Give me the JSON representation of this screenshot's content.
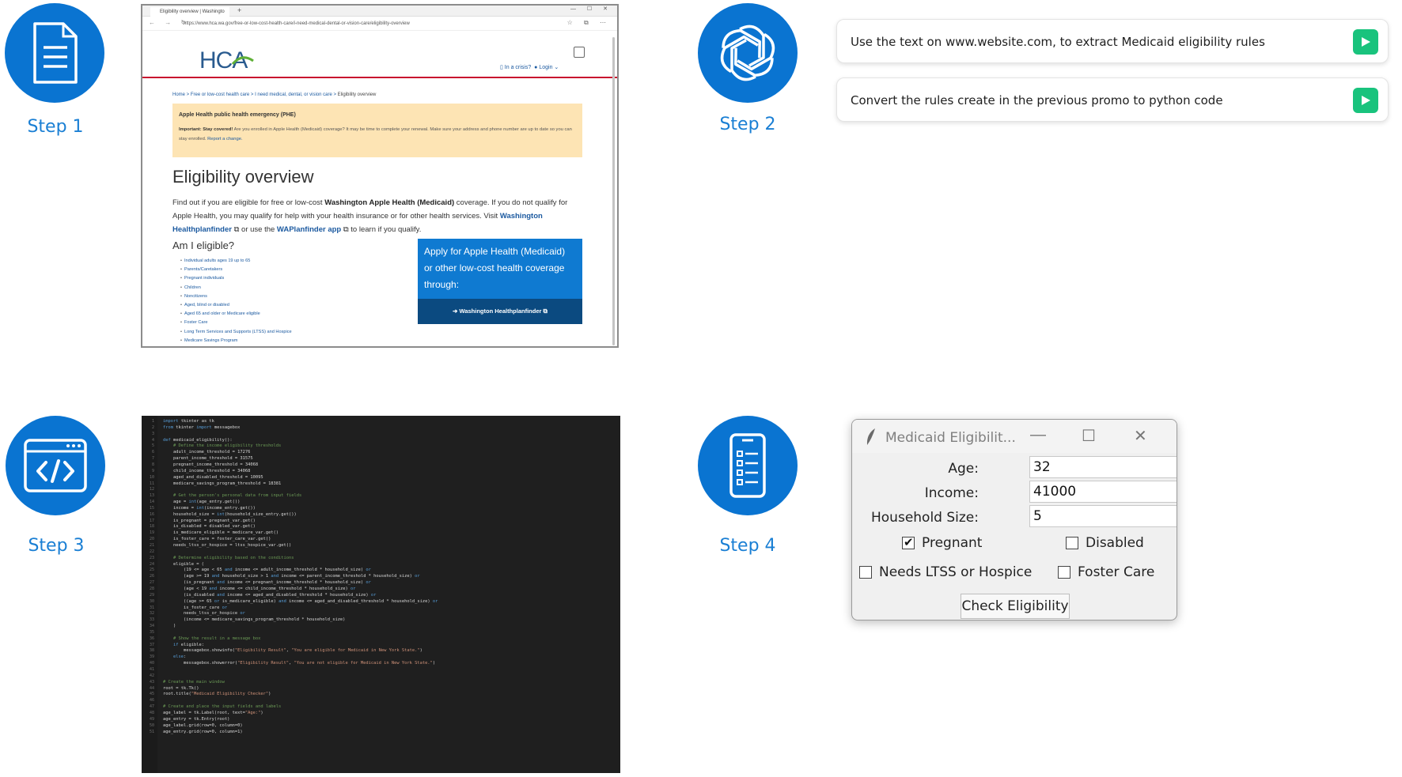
{
  "steps": [
    {
      "label": "Step 1",
      "icon": "document-icon"
    },
    {
      "label": "Step 2",
      "icon": "openai-logo-icon"
    },
    {
      "label": "Step 3",
      "icon": "code-window-icon"
    },
    {
      "label": "Step 4",
      "icon": "mobile-checklist-icon"
    }
  ],
  "browser": {
    "tab_title": "Eligibility overview | Washingto",
    "url": "https://www.hca.wa.gov/free-or-low-cost-health-care/i-need-medical-dental-or-vision-care/eligibility-overview",
    "logo": "HCA",
    "crisis_label": "In a crisis?",
    "login_label": "Login",
    "breadcrumb": [
      "Home",
      "Free or low-cost health care",
      "I need medical, dental, or vision care",
      "Eligibility overview"
    ],
    "phe": {
      "title": "Apple Health public health emergency (PHE)",
      "bold": "Important: Stay covered!",
      "body": " Are you enrolled in Apple Health (Medicaid) coverage? It may be time to complete your renewal. Make sure your address and phone number are up to date so you can stay enrolled. ",
      "link": "Report a change."
    },
    "heading": "Eligibility overview",
    "intro": {
      "t1": "Find out if you are eligible for free or low-cost ",
      "b1": "Washington Apple Health (Medicaid)",
      "t2": " coverage. If you do not qualify for Apple Health, you may qualify for help with your health insurance or for other health services. Visit ",
      "l1": "Washington Healthplanfinder",
      "t3": " or use the ",
      "l2": "WAPlanfinder app",
      "t4": " to learn if you qualify."
    },
    "subheading": "Am I eligible?",
    "list": [
      "Individual adults ages 19 up to 65",
      "Parents/Caretakers",
      "Pregnant individuals",
      "Children",
      "Noncitizens",
      "Aged, blind or disabled",
      "Aged 65 and older or Medicare eligible",
      "Foster Care",
      "Long Term Services and Supports (LTSS) and Hospice",
      "Medicare Savings Program"
    ],
    "apply_text": "Apply for Apple Health (Medicaid) or other low-cost health coverage through:",
    "apply_button": "Washington Healthplanfinder"
  },
  "prompts": [
    "Use the text on www.website.com, to extract Medicaid eligibility rules",
    "Convert the rules create in the previous promo to python code"
  ],
  "code_lines": [
    "import tkinter as tk",
    "from tkinter import messagebox",
    "",
    "def medicaid_eligibility():",
    "    # Define the income eligibility thresholds",
    "    adult_income_threshold = 17276",
    "    parent_income_threshold = 31575",
    "    pregnant_income_threshold = 34068",
    "    child_income_threshold = 34068",
    "    aged_and_disabled_threshold = 10095",
    "    medicare_savings_program_threshold = 18381",
    "",
    "    # Get the person's personal data from input fields",
    "    age = int(age_entry.get())",
    "    income = int(income_entry.get())",
    "    household_size = int(household_size_entry.get())",
    "    is_pregnant = pregnant_var.get()",
    "    is_disabled = disabled_var.get()",
    "    is_medicare_eligible = medicare_var.get()",
    "    is_foster_care = foster_care_var.get()",
    "    needs_ltss_or_hospice = ltss_hospice_var.get()",
    "",
    "    # Determine eligibility based on the conditions",
    "    eligible = (",
    "        (19 <= age < 65 and income <= adult_income_threshold * household_size) or",
    "        (age >= 19 and household_size > 1 and income <= parent_income_threshold * household_size) or",
    "        (is_pregnant and income <= pregnant_income_threshold * household_size) or",
    "        (age < 19 and income <= child_income_threshold * household_size) or",
    "        (is_disabled and income <= aged_and_disabled_threshold * household_size) or",
    "        ((age >= 65 or is_medicare_eligible) and income <= aged_and_disabled_threshold * household_size) or",
    "        is_foster_care or",
    "        needs_ltss_or_hospice or",
    "        (income <= medicare_savings_program_threshold * household_size)",
    "    )",
    "",
    "    # Show the result in a message box",
    "    if eligible:",
    "        messagebox.showinfo(\"Eligibility Result\", \"You are eligible for Medicaid in New York State.\")",
    "    else:",
    "        messagebox.showerror(\"Eligibility Result\", \"You are not eligible for Medicaid in New York State.\")",
    "",
    "",
    "# Create the main window",
    "root = tk.Tk()",
    "root.title(\"Medicaid Eligibility Checker\")",
    "",
    "# Create and place the input fields and labels",
    "age_label = tk.Label(root, text=\"Age:\")",
    "age_entry = tk.Entry(root)",
    "age_label.grid(row=0, column=0)",
    "age_entry.grid(row=0, column=1)"
  ],
  "tk_window": {
    "title": "Medicaid Eligibilit...",
    "fields": [
      {
        "label": "Age:",
        "value": "32"
      },
      {
        "label": "Income:",
        "value": "41000"
      },
      {
        "label": "Household Size:",
        "value": "5"
      }
    ],
    "checkboxes": [
      {
        "label": "Pregnant",
        "checked": true
      },
      {
        "label": "Disabled",
        "checked": false
      },
      {
        "label": "Needs LTSS or Hospice",
        "checked": false
      },
      {
        "label": "Foster Care",
        "checked": false
      }
    ],
    "button": "Check Eligibility"
  },
  "colors": {
    "step_circle": "#0a74d1",
    "step_label": "#1a7fd4",
    "send_button": "#19c37d",
    "hca_red_rule": "#c8102e",
    "phe_banner": "#fde4b4",
    "apply_box": "#0f7ad1",
    "code_bg": "#1f1f1f"
  }
}
